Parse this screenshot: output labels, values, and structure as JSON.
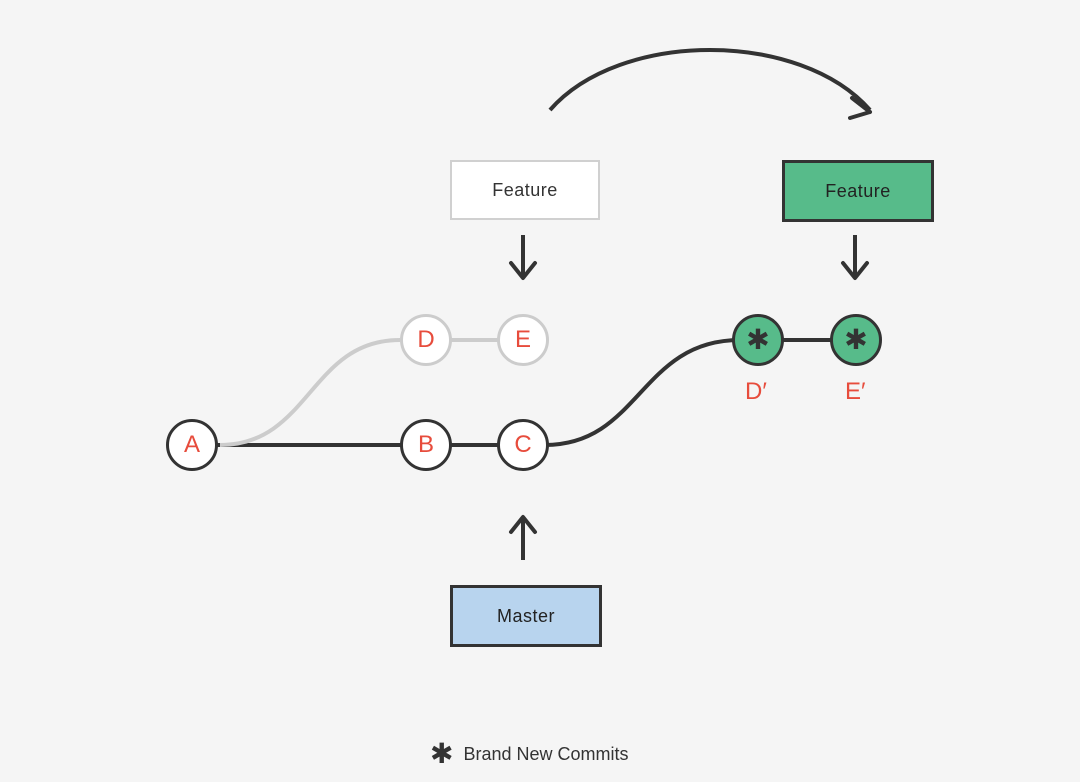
{
  "boxes": {
    "feature_old": "Feature",
    "feature_new": "Feature",
    "master": "Master"
  },
  "nodes": {
    "A": "A",
    "B": "B",
    "C": "C",
    "D": "D",
    "E": "E",
    "Dprime": "✱",
    "Eprime": "✱"
  },
  "prime_labels": {
    "Dprime": "D′",
    "Eprime": "E′"
  },
  "legend": {
    "icon": "✱",
    "text": "Brand New Commits"
  },
  "colors": {
    "bg": "#f5f5f5",
    "dark": "#333333",
    "light": "#cccccc",
    "green": "#57bb8a",
    "blue": "#b8d4ee",
    "red": "#e74c3c"
  }
}
